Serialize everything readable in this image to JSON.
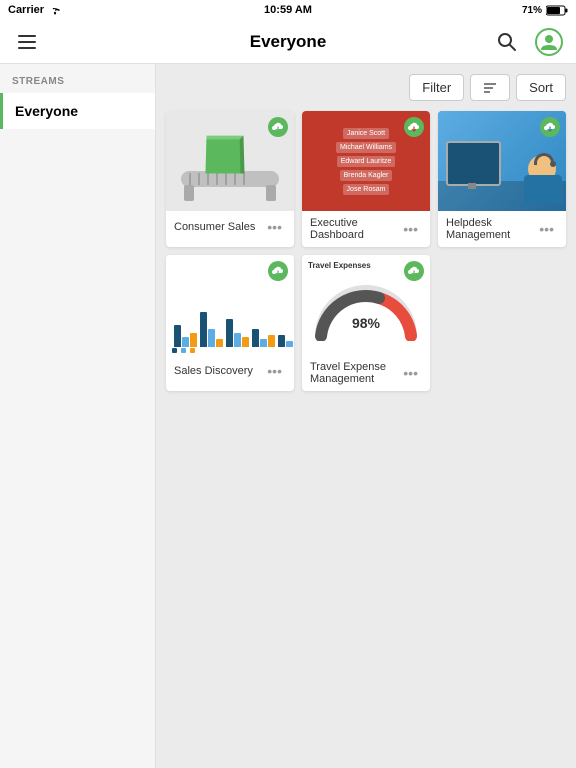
{
  "statusBar": {
    "carrier": "Carrier",
    "wifi": true,
    "time": "10:59 AM",
    "battery": "71%"
  },
  "navBar": {
    "title": "Everyone",
    "searchIcon": "search-icon",
    "profileIcon": "profile-icon",
    "menuIcon": "menu-icon"
  },
  "sidebar": {
    "streamsLabel": "STREAMS",
    "items": [
      {
        "id": "everyone",
        "label": "Everyone",
        "active": true
      }
    ]
  },
  "toolbar": {
    "filterLabel": "Filter",
    "sortIcon": "sort-icon",
    "sortLabel": "Sort"
  },
  "apps": [
    {
      "id": "consumer-sales",
      "title": "Consumer Sales",
      "type": "conveyor"
    },
    {
      "id": "executive-dashboard",
      "title": "Executive Dashboard",
      "type": "exec",
      "names": [
        "Janice Scott",
        "Michael Williams",
        "Edward Lauritze",
        "Brenda Kagler",
        "Jose Rosam"
      ]
    },
    {
      "id": "helpdesk-management",
      "title": "Helpdesk Management",
      "type": "helpdesk"
    },
    {
      "id": "sales-discovery",
      "title": "Sales Discovery",
      "type": "barchart"
    },
    {
      "id": "travel-expense-management",
      "title": "Travel Expense Management",
      "type": "gauge",
      "gaugeLabel": "Travel Expenses",
      "gaugeValue": "98%",
      "gaugeMin": "0%",
      "gaugeMax": "133%"
    }
  ],
  "icons": {
    "moreMenu": "•••",
    "cloudSync": "↑"
  }
}
